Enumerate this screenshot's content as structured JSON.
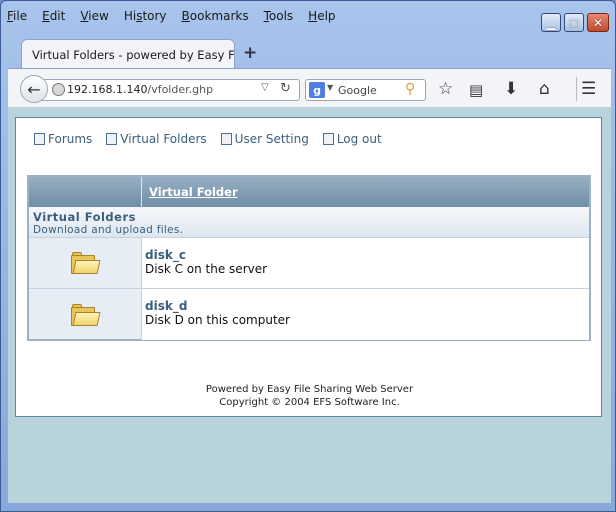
{
  "menu": [
    "File",
    "Edit",
    "View",
    "History",
    "Bookmarks",
    "Tools",
    "Help"
  ],
  "menu_accel": [
    "F",
    "E",
    "V",
    "s",
    "B",
    "T",
    "H"
  ],
  "tab": {
    "title": "Virtual Folders - powered by Easy File ..."
  },
  "url": {
    "host": "192.168.1.140",
    "path": "/vfolder.ghp"
  },
  "search": {
    "engine_label": "Google",
    "engine_icon": "g"
  },
  "toplinks": [
    {
      "label": "Forums",
      "icon": "forums-icon"
    },
    {
      "label": "Virtual Folders",
      "icon": "folders-icon"
    },
    {
      "label": "User Setting",
      "icon": "user-icon"
    },
    {
      "label": "Log out",
      "icon": "logout-icon"
    }
  ],
  "table": {
    "header": "Virtual Folder",
    "section_title": "Virtual Folders",
    "section_subtitle": "Download and upload files.",
    "rows": [
      {
        "name": "disk_c",
        "desc": "Disk C on the server"
      },
      {
        "name": "disk_d",
        "desc": "Disk D on this computer"
      }
    ]
  },
  "footer": {
    "line1": "Powered by Easy File Sharing Web Server",
    "line2": "Copyright © 2004 EFS Software Inc."
  },
  "colors": {
    "content_bg": "#b8d3dc",
    "link": "#3a5f7e",
    "header_bar": "#6f8ea8"
  }
}
